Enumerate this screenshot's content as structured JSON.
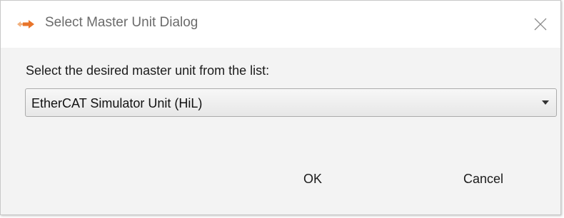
{
  "window": {
    "title": "Select Master Unit Dialog",
    "icon": "orange-arrow-icon",
    "close_icon": "close-icon"
  },
  "form": {
    "prompt": "Select the desired master unit from the list:",
    "master_unit_selected": "EtherCAT Simulator Unit (HiL)"
  },
  "buttons": {
    "ok_label": "OK",
    "cancel_label": "Cancel"
  },
  "colors": {
    "icon_accent": "#e8742a",
    "title_text": "#6b6b6b",
    "dialog_background": "#f3f3f3"
  }
}
